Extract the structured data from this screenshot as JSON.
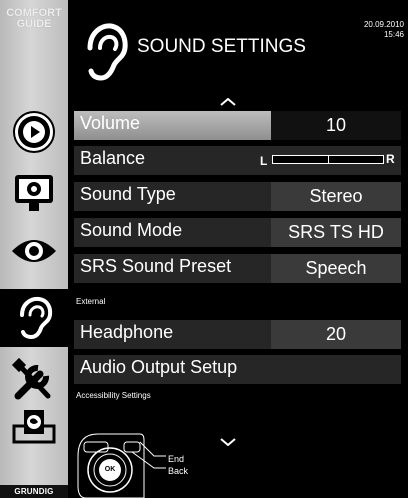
{
  "sidebar": {
    "comfort_guide_line1": "COMFORT",
    "comfort_guide_line2": "GUIDE",
    "logo": "GRUNDIG"
  },
  "header": {
    "title": "SOUND SETTINGS",
    "date": "20.09.2010",
    "time": "15:46"
  },
  "menu": {
    "volume": {
      "label": "Volume",
      "value": "10"
    },
    "balance": {
      "label": "Balance",
      "left": "L",
      "right": "R",
      "level": 0.5
    },
    "sound_type": {
      "label": "Sound Type",
      "value": "Stereo"
    },
    "sound_mode": {
      "label": "Sound Mode",
      "value": "SRS TS HD"
    },
    "srs_preset": {
      "label": "SRS Sound Preset",
      "value": "Speech"
    },
    "external_section": "External",
    "headphone": {
      "label": "Headphone",
      "value": "20"
    },
    "audio_output": {
      "label": "Audio Output Setup"
    },
    "accessibility_section": "Accessibility Settings"
  },
  "remote": {
    "ok": "OK",
    "end": "End",
    "back": "Back"
  },
  "colors": {
    "sidebar": "#c8c8c8",
    "row": "#262626",
    "value_bg": "#3a3a3a",
    "selected": "#a9a9a9"
  }
}
